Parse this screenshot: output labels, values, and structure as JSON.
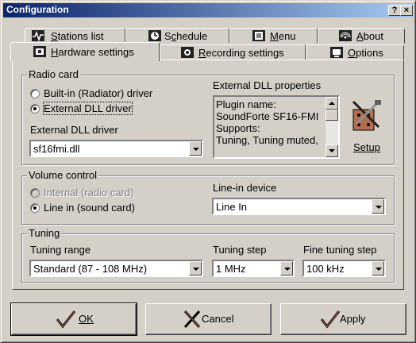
{
  "window": {
    "title": "Configuration",
    "help_btn": "?",
    "close_btn": "×"
  },
  "tabs_row1": [
    {
      "label": "Stations list",
      "ukey": "S",
      "rest": "tations list",
      "icon": "activity-icon"
    },
    {
      "label": "Schedule",
      "ukey": "c",
      "pre": "S",
      "rest": "hedule",
      "icon": "clock-icon"
    },
    {
      "label": "Menu",
      "ukey": "M",
      "rest": "enu",
      "icon": "menu-icon"
    },
    {
      "label": "About",
      "ukey": "A",
      "rest": "bout",
      "icon": "antenna-icon"
    }
  ],
  "tabs_row2": [
    {
      "label": "Hardware settings",
      "ukey": "H",
      "rest": "ardware settings",
      "icon": "hardware-icon",
      "active": true
    },
    {
      "label": "Recording settings",
      "ukey": "R",
      "rest": "ecording settings",
      "icon": "record-icon"
    },
    {
      "label": "Options",
      "ukey": "O",
      "rest": "ptions",
      "icon": "options-icon"
    }
  ],
  "radio_card": {
    "title": "Radio card",
    "opt_builtin": "Built-in (Radiator) driver",
    "opt_external": "External DLL driver",
    "driver_label": "External DLL driver",
    "driver_value": "sf16fmi.dll",
    "props_label": "External DLL properties",
    "props_lines": [
      "Plugin name:",
      "SoundForte SF16-FMI",
      "Supports:",
      "Tuning, Tuning muted,"
    ],
    "setup_label": "Setup"
  },
  "volume": {
    "title": "Volume control",
    "opt_internal": "Internal (radio card)",
    "opt_linein": "Line in (sound card)",
    "device_label": "Line-in device",
    "device_value": "Line In"
  },
  "tuning": {
    "title": "Tuning",
    "range_label": "Tuning range",
    "range_value": "Standard (87 - 108 MHz)",
    "step_label": "Tuning step",
    "step_value": "1 MHz",
    "fine_label": "Fine tuning step",
    "fine_value": "100 kHz"
  },
  "buttons": {
    "ok": "OK",
    "cancel": "Cancel",
    "apply": "Apply"
  },
  "colors": {
    "titlebar_start": "#0a246a",
    "titlebar_end": "#a6caf0",
    "face": "#d4d0c8"
  }
}
